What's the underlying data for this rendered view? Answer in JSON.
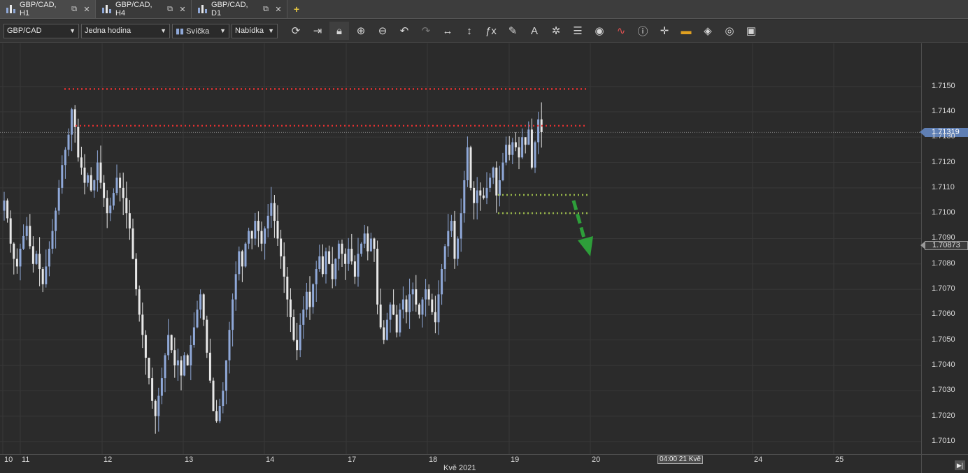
{
  "tabs": [
    {
      "label": "GBP/CAD, H1",
      "active": true
    },
    {
      "label": "GBP/CAD, H4",
      "active": false
    },
    {
      "label": "GBP/CAD, D1",
      "active": false
    }
  ],
  "toolbar": {
    "symbol": "GBP/CAD",
    "period": "Jedna hodina",
    "chart_type": "Svíčka",
    "price_side": "Nabídka",
    "icons": [
      "refresh-icon",
      "shift-chart-icon",
      "lock-icon",
      "zoom-in-icon",
      "zoom-out-icon",
      "undo-icon",
      "redo-icon",
      "horizontal-scale-icon",
      "vertical-scale-icon",
      "indicators-icon",
      "drawing-pencil-icon",
      "text-tool-icon",
      "pattern-icon",
      "layers-icon",
      "eye-icon",
      "oscillator-icon",
      "info-icon",
      "crosshair-icon",
      "color-scheme-icon",
      "fill-icon",
      "settings-icon",
      "save-icon"
    ]
  },
  "yaxis": {
    "labels": [
      "1.7150",
      "1.7140",
      "1.7130",
      "1.7120",
      "1.7110",
      "1.7100",
      "1.7090",
      "1.7080",
      "1.7070",
      "1.7060",
      "1.7050",
      "1.7040",
      "1.7030",
      "1.7020",
      "1.7010"
    ],
    "current_price": "1.71319",
    "ref_price": "1.70873"
  },
  "xaxis": {
    "labels": [
      "10",
      "11",
      "12",
      "13",
      "14",
      "17",
      "18",
      "19",
      "20",
      "24",
      "25"
    ],
    "month": "Kvě 2021",
    "cursor_label": "04:00 21 Kvě"
  },
  "colors": {
    "bull": "#8fa8d8",
    "bear": "#e8e8e8",
    "resistance": "#e23030",
    "support": "#9ab84a",
    "arrow": "#2e9e3a"
  },
  "chart_data": {
    "type": "candlestick",
    "symbol": "GBP/CAD",
    "timeframe": "H1",
    "y_range": [
      1.7005,
      1.7167
    ],
    "current_price": 1.71319,
    "ref_price": 1.70873,
    "resistance_levels": [
      1.7149,
      1.71345
    ],
    "support_levels": [
      1.71072,
      1.71
    ],
    "closes": [
      1.7105,
      1.7098,
      1.7088,
      1.7082,
      1.7079,
      1.7086,
      1.7091,
      1.7095,
      1.7087,
      1.708,
      1.7084,
      1.7078,
      1.7072,
      1.7079,
      1.7086,
      1.7093,
      1.7101,
      1.711,
      1.7119,
      1.7125,
      1.7131,
      1.7141,
      1.7134,
      1.7122,
      1.7118,
      1.7112,
      1.7115,
      1.7109,
      1.7113,
      1.712,
      1.7112,
      1.7106,
      1.71,
      1.7103,
      1.7108,
      1.7114,
      1.711,
      1.7106,
      1.71,
      1.7094,
      1.7082,
      1.707,
      1.706,
      1.7052,
      1.7043,
      1.7035,
      1.7026,
      1.702,
      1.7028,
      1.7035,
      1.7044,
      1.7052,
      1.7046,
      1.704,
      1.7042,
      1.7036,
      1.7044,
      1.704,
      1.7048,
      1.7055,
      1.7062,
      1.7068,
      1.7058,
      1.7045,
      1.7034,
      1.7022,
      1.7018,
      1.7024,
      1.703,
      1.7042,
      1.7054,
      1.7066,
      1.7076,
      1.7085,
      1.7079,
      1.7088,
      1.7093,
      1.709,
      1.7097,
      1.7093,
      1.7088,
      1.7094,
      1.7099,
      1.7104,
      1.7097,
      1.709,
      1.7083,
      1.7075,
      1.7066,
      1.7059,
      1.705,
      1.7046,
      1.7056,
      1.7062,
      1.7069,
      1.7063,
      1.7072,
      1.7078,
      1.7083,
      1.7076,
      1.7085,
      1.708,
      1.7074,
      1.7082,
      1.7088,
      1.7084,
      1.708,
      1.7086,
      1.7081,
      1.7075,
      1.7084,
      1.7088,
      1.7092,
      1.7085,
      1.709,
      1.7086,
      1.7064,
      1.7055,
      1.705,
      1.7058,
      1.7064,
      1.706,
      1.7053,
      1.7062,
      1.7066,
      1.7061,
      1.7068,
      1.707,
      1.7064,
      1.706,
      1.7066,
      1.707,
      1.7066,
      1.7061,
      1.7057,
      1.7068,
      1.7078,
      1.7087,
      1.7093,
      1.7097,
      1.7082,
      1.709,
      1.71,
      1.7113,
      1.7126,
      1.711,
      1.7104,
      1.7109,
      1.7107,
      1.7106,
      1.711,
      1.7114,
      1.7118,
      1.7107,
      1.7113,
      1.712,
      1.7127,
      1.7123,
      1.7128,
      1.7126,
      1.7122,
      1.713,
      1.7127,
      1.7133,
      1.7118,
      1.7128,
      1.7137,
      1.7132
    ]
  }
}
